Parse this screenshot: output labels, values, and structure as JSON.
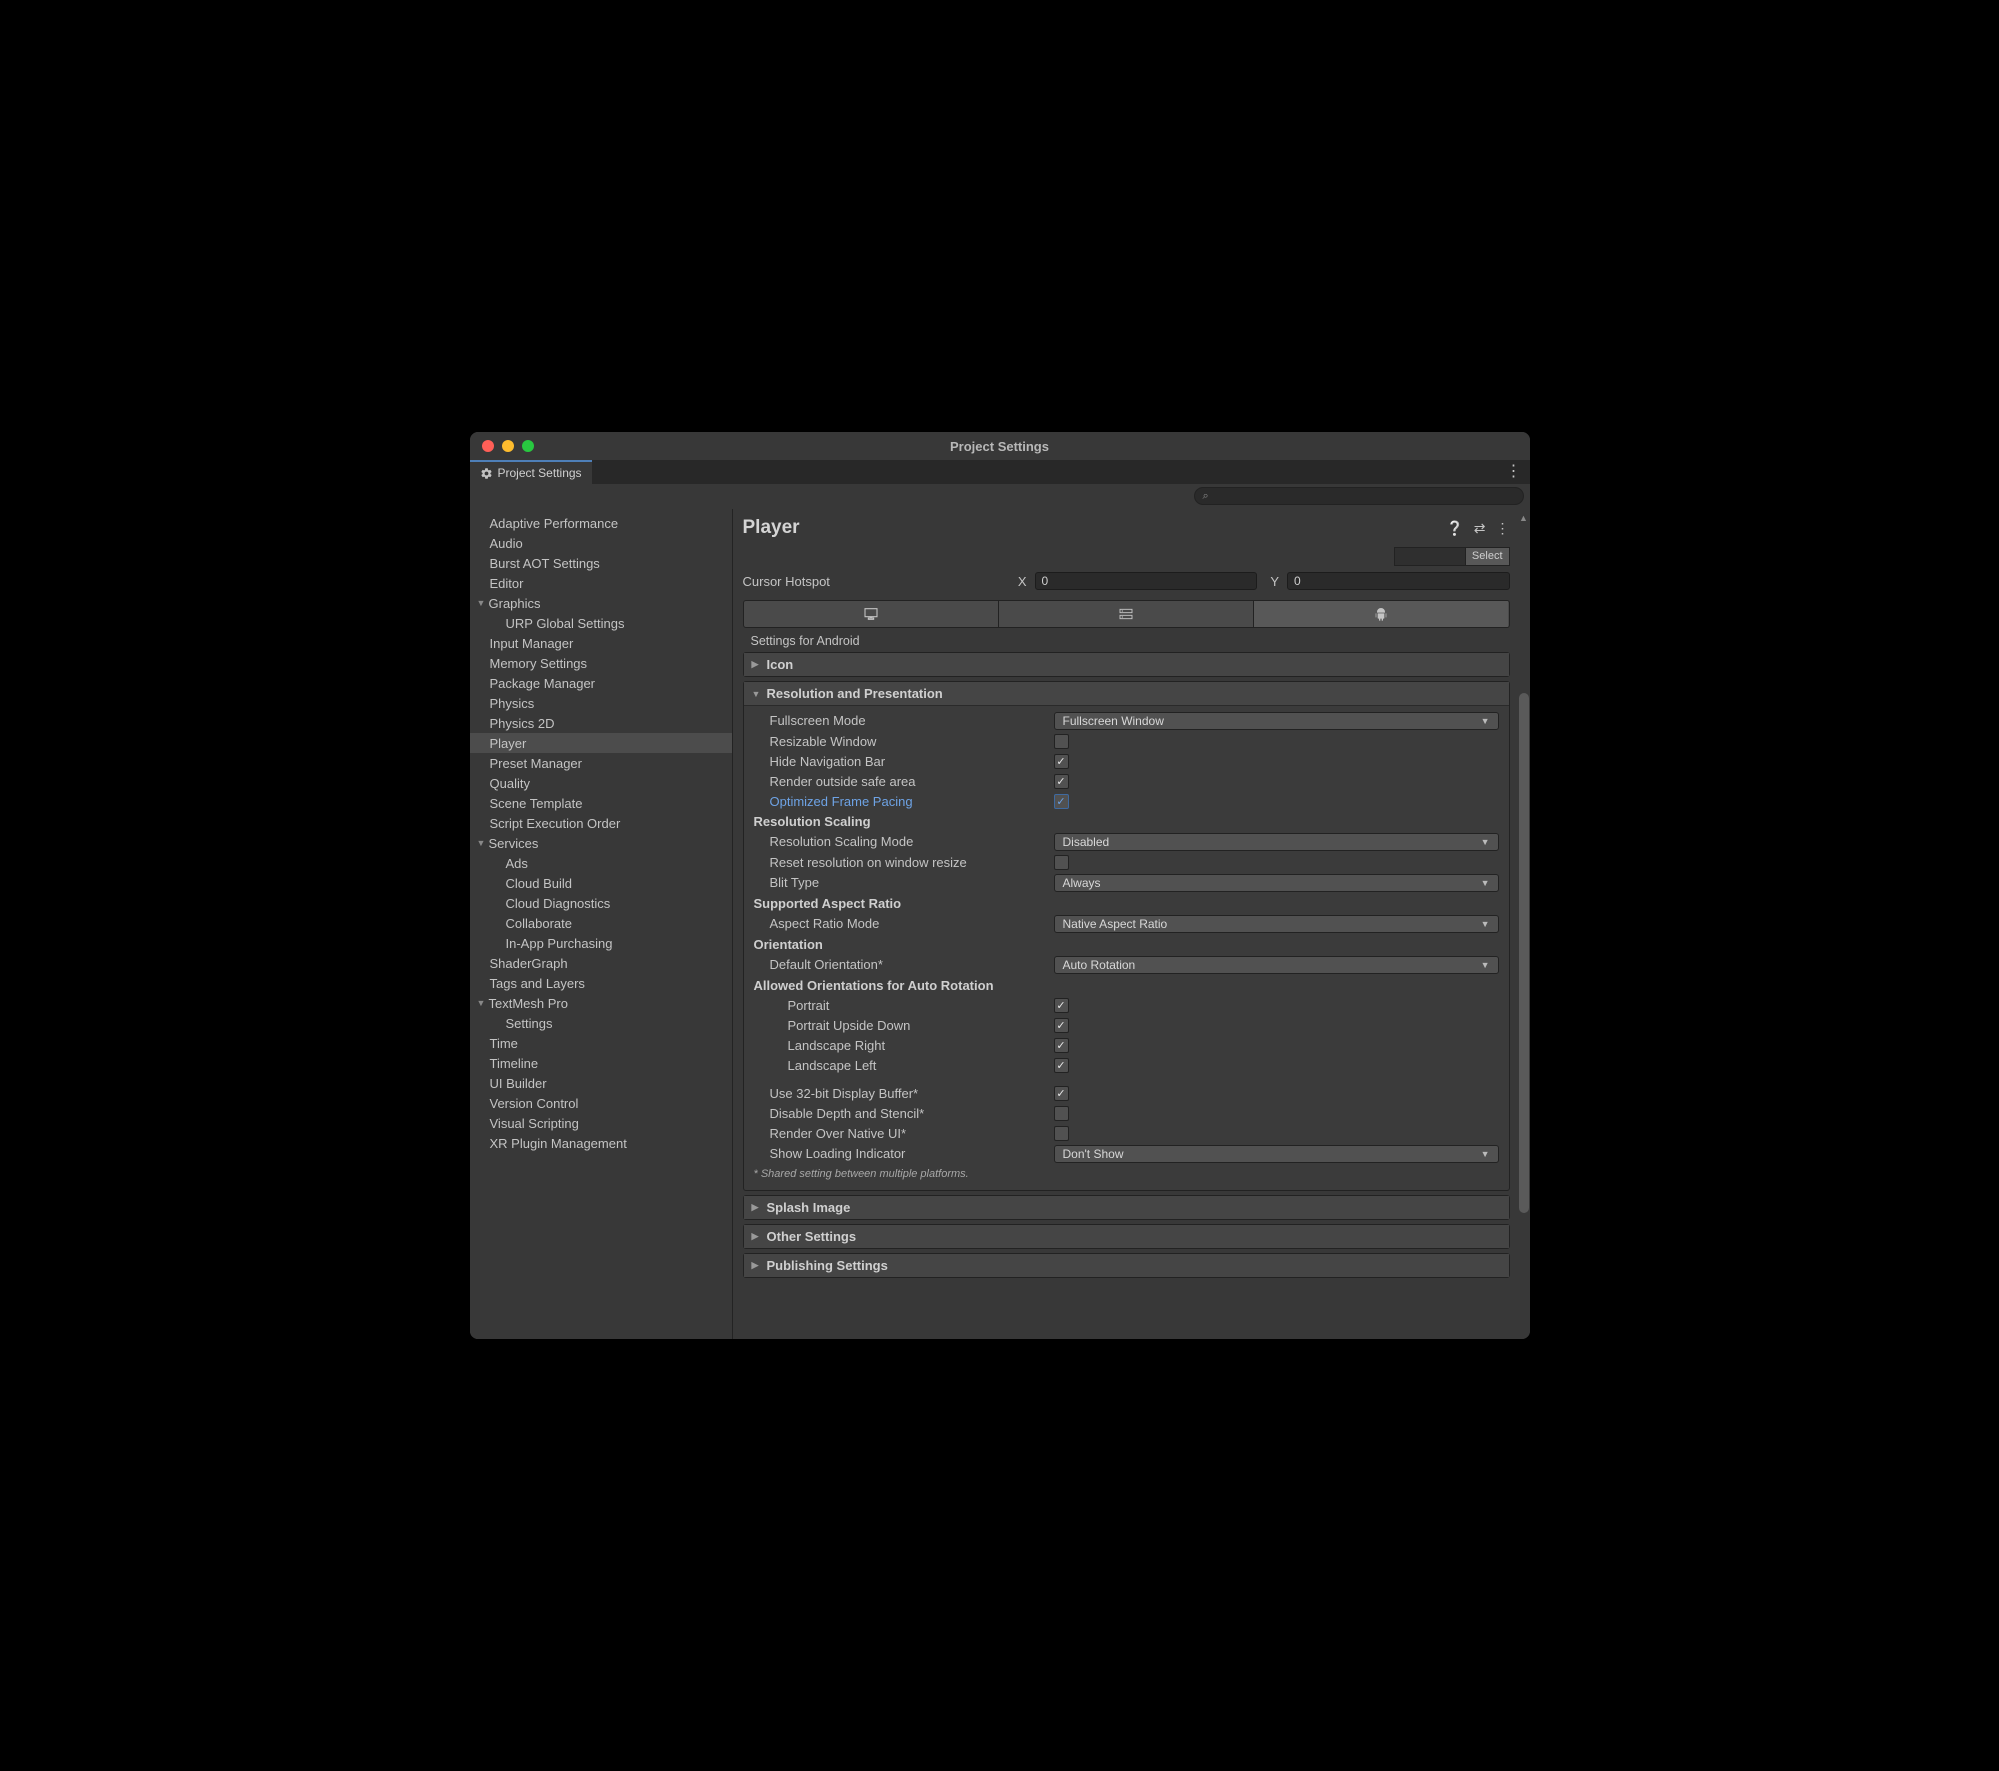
{
  "window": {
    "title": "Project Settings"
  },
  "tab": {
    "label": "Project Settings"
  },
  "search": {
    "placeholder": ""
  },
  "sidebar": {
    "items": [
      {
        "label": "Adaptive Performance",
        "depth": 0,
        "fold": null
      },
      {
        "label": "Audio",
        "depth": 0,
        "fold": null
      },
      {
        "label": "Burst AOT Settings",
        "depth": 0,
        "fold": null
      },
      {
        "label": "Editor",
        "depth": 0,
        "fold": null
      },
      {
        "label": "Graphics",
        "depth": 0,
        "fold": "open"
      },
      {
        "label": "URP Global Settings",
        "depth": 1,
        "fold": null
      },
      {
        "label": "Input Manager",
        "depth": 0,
        "fold": null
      },
      {
        "label": "Memory Settings",
        "depth": 0,
        "fold": null
      },
      {
        "label": "Package Manager",
        "depth": 0,
        "fold": null
      },
      {
        "label": "Physics",
        "depth": 0,
        "fold": null
      },
      {
        "label": "Physics 2D",
        "depth": 0,
        "fold": null
      },
      {
        "label": "Player",
        "depth": 0,
        "fold": null,
        "selected": true
      },
      {
        "label": "Preset Manager",
        "depth": 0,
        "fold": null
      },
      {
        "label": "Quality",
        "depth": 0,
        "fold": null
      },
      {
        "label": "Scene Template",
        "depth": 0,
        "fold": null
      },
      {
        "label": "Script Execution Order",
        "depth": 0,
        "fold": null
      },
      {
        "label": "Services",
        "depth": 0,
        "fold": "open"
      },
      {
        "label": "Ads",
        "depth": 1,
        "fold": null
      },
      {
        "label": "Cloud Build",
        "depth": 1,
        "fold": null
      },
      {
        "label": "Cloud Diagnostics",
        "depth": 1,
        "fold": null
      },
      {
        "label": "Collaborate",
        "depth": 1,
        "fold": null
      },
      {
        "label": "In-App Purchasing",
        "depth": 1,
        "fold": null
      },
      {
        "label": "ShaderGraph",
        "depth": 0,
        "fold": null
      },
      {
        "label": "Tags and Layers",
        "depth": 0,
        "fold": null
      },
      {
        "label": "TextMesh Pro",
        "depth": 0,
        "fold": "open"
      },
      {
        "label": "Settings",
        "depth": 1,
        "fold": null
      },
      {
        "label": "Time",
        "depth": 0,
        "fold": null
      },
      {
        "label": "Timeline",
        "depth": 0,
        "fold": null
      },
      {
        "label": "UI Builder",
        "depth": 0,
        "fold": null
      },
      {
        "label": "Version Control",
        "depth": 0,
        "fold": null
      },
      {
        "label": "Visual Scripting",
        "depth": 0,
        "fold": null
      },
      {
        "label": "XR Plugin Management",
        "depth": 0,
        "fold": null
      }
    ]
  },
  "page": {
    "title": "Player",
    "selectBtn": "Select",
    "cursorHotspot": {
      "label": "Cursor Hotspot",
      "xLabel": "X",
      "xVal": "0",
      "yLabel": "Y",
      "yVal": "0"
    },
    "platformCaption": "Settings for Android",
    "sections": {
      "icon": "Icon",
      "resPres": "Resolution and Presentation",
      "splash": "Splash Image",
      "other": "Other Settings",
      "publish": "Publishing Settings"
    },
    "props": {
      "fullscreenMode": {
        "label": "Fullscreen Mode",
        "value": "Fullscreen Window"
      },
      "resizable": {
        "label": "Resizable Window",
        "checked": false
      },
      "hideNav": {
        "label": "Hide Navigation Bar",
        "checked": true
      },
      "renderOutside": {
        "label": "Render outside safe area",
        "checked": true
      },
      "optFrame": {
        "label": "Optimized Frame Pacing",
        "checked": true
      },
      "resScalingHeader": "Resolution Scaling",
      "resScalingMode": {
        "label": "Resolution Scaling Mode",
        "value": "Disabled"
      },
      "resetRes": {
        "label": "Reset resolution on window resize",
        "checked": false
      },
      "blitType": {
        "label": "Blit Type",
        "value": "Always"
      },
      "aspectHeader": "Supported Aspect Ratio",
      "aspectMode": {
        "label": "Aspect Ratio Mode",
        "value": "Native Aspect Ratio"
      },
      "orientHeader": "Orientation",
      "defaultOrient": {
        "label": "Default Orientation*",
        "value": "Auto Rotation"
      },
      "allowedHeader": "Allowed Orientations for Auto Rotation",
      "portrait": {
        "label": "Portrait",
        "checked": true
      },
      "portraitUD": {
        "label": "Portrait Upside Down",
        "checked": true
      },
      "landR": {
        "label": "Landscape Right",
        "checked": true
      },
      "landL": {
        "label": "Landscape Left",
        "checked": true
      },
      "use32": {
        "label": "Use 32-bit Display Buffer*",
        "checked": true
      },
      "disableDepth": {
        "label": "Disable Depth and Stencil*",
        "checked": false
      },
      "renderNative": {
        "label": "Render Over Native UI*",
        "checked": false
      },
      "loadingInd": {
        "label": "Show Loading Indicator",
        "value": "Don't Show"
      }
    },
    "footnote": "* Shared setting between multiple platforms."
  }
}
